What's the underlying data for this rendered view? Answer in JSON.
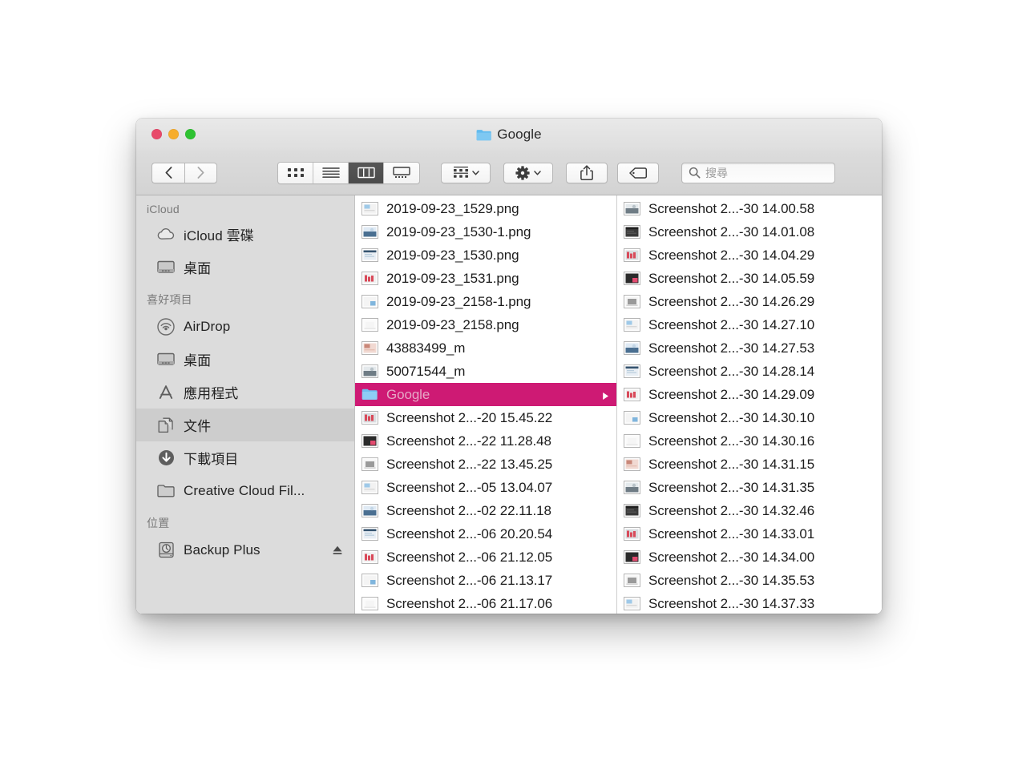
{
  "window": {
    "title": "Google",
    "title_icon": "blue-folder-icon",
    "traffic_lights": [
      {
        "name": "close",
        "color": "#e8496a"
      },
      {
        "name": "minimize",
        "color": "#f6ad2d"
      },
      {
        "name": "maximize",
        "color": "#2ec231"
      }
    ]
  },
  "toolbar": {
    "back_label": "",
    "forward_label": "",
    "view_modes": [
      {
        "name": "icon-view",
        "active": false
      },
      {
        "name": "list-view",
        "active": false
      },
      {
        "name": "column-view",
        "active": true
      },
      {
        "name": "gallery-view",
        "active": false
      }
    ],
    "arrange_label": "",
    "action_label": "",
    "share_label": "",
    "tag_label": "",
    "accent_selected": "#4b4b4b"
  },
  "search": {
    "placeholder": "搜尋",
    "value": ""
  },
  "sidebar": {
    "sections": [
      {
        "title": "iCloud",
        "items": [
          {
            "label": "iCloud 雲碟",
            "icon": "cloud-icon",
            "selected": false,
            "eject": false
          },
          {
            "label": "桌面",
            "icon": "desktop-icon",
            "selected": false,
            "eject": false
          }
        ]
      },
      {
        "title": "喜好項目",
        "items": [
          {
            "label": "AirDrop",
            "icon": "airdrop-icon",
            "selected": false,
            "eject": false
          },
          {
            "label": "桌面",
            "icon": "desktop-icon",
            "selected": false,
            "eject": false
          },
          {
            "label": "應用程式",
            "icon": "applications-icon",
            "selected": false,
            "eject": false
          },
          {
            "label": "文件",
            "icon": "documents-icon",
            "selected": true,
            "eject": false
          },
          {
            "label": "下載項目",
            "icon": "downloads-icon",
            "selected": false,
            "eject": false
          },
          {
            "label": "Creative Cloud Fil...",
            "icon": "folder-icon",
            "selected": false,
            "eject": false
          }
        ]
      },
      {
        "title": "位置",
        "items": [
          {
            "label": "Backup Plus",
            "icon": "backup-disk-icon",
            "selected": false,
            "eject": true
          }
        ]
      }
    ]
  },
  "browser": {
    "selection_color": "#ce1a74",
    "columns": [
      {
        "name": "column-1",
        "rows": [
          {
            "name": "2019-09-23_1529.png",
            "icon": "image-thumbnail",
            "kind": "file",
            "selected": false,
            "disclosure": false
          },
          {
            "name": "2019-09-23_1530-1.png",
            "icon": "image-thumbnail",
            "kind": "file",
            "selected": false,
            "disclosure": false
          },
          {
            "name": "2019-09-23_1530.png",
            "icon": "image-thumbnail",
            "kind": "file",
            "selected": false,
            "disclosure": false
          },
          {
            "name": "2019-09-23_1531.png",
            "icon": "image-thumbnail",
            "kind": "file",
            "selected": false,
            "disclosure": false
          },
          {
            "name": "2019-09-23_2158-1.png",
            "icon": "image-thumbnail",
            "kind": "file",
            "selected": false,
            "disclosure": false
          },
          {
            "name": "2019-09-23_2158.png",
            "icon": "image-thumbnail",
            "kind": "file",
            "selected": false,
            "disclosure": false
          },
          {
            "name": "43883499_m",
            "icon": "image-thumbnail",
            "kind": "file",
            "selected": false,
            "disclosure": false
          },
          {
            "name": "50071544_m",
            "icon": "image-thumbnail",
            "kind": "file",
            "selected": false,
            "disclosure": false
          },
          {
            "name": "Google",
            "icon": "blue-folder-icon",
            "kind": "folder",
            "selected": true,
            "disclosure": true
          },
          {
            "name": "Screenshot 2...-20 15.45.22",
            "icon": "image-thumbnail",
            "kind": "file",
            "selected": false,
            "disclosure": false
          },
          {
            "name": "Screenshot 2...-22 11.28.48",
            "icon": "image-thumbnail",
            "kind": "file",
            "selected": false,
            "disclosure": false
          },
          {
            "name": "Screenshot 2...-22 13.45.25",
            "icon": "image-thumbnail",
            "kind": "file",
            "selected": false,
            "disclosure": false
          },
          {
            "name": "Screenshot 2...-05 13.04.07",
            "icon": "image-thumbnail",
            "kind": "file",
            "selected": false,
            "disclosure": false
          },
          {
            "name": "Screenshot 2...-02 22.11.18",
            "icon": "image-thumbnail",
            "kind": "file",
            "selected": false,
            "disclosure": false
          },
          {
            "name": "Screenshot 2...-06 20.20.54",
            "icon": "image-thumbnail",
            "kind": "file",
            "selected": false,
            "disclosure": false
          },
          {
            "name": "Screenshot 2...-06 21.12.05",
            "icon": "image-thumbnail",
            "kind": "file",
            "selected": false,
            "disclosure": false
          },
          {
            "name": "Screenshot 2...-06 21.13.17",
            "icon": "image-thumbnail",
            "kind": "file",
            "selected": false,
            "disclosure": false
          },
          {
            "name": "Screenshot 2...-06 21.17.06",
            "icon": "image-thumbnail",
            "kind": "file",
            "selected": false,
            "disclosure": false
          }
        ]
      },
      {
        "name": "column-2",
        "rows": [
          {
            "name": "Screenshot 2...-30 14.00.58",
            "icon": "image-thumbnail",
            "kind": "file",
            "selected": false,
            "disclosure": false
          },
          {
            "name": "Screenshot 2...-30 14.01.08",
            "icon": "image-thumbnail",
            "kind": "file",
            "selected": false,
            "disclosure": false
          },
          {
            "name": "Screenshot 2...-30 14.04.29",
            "icon": "image-thumbnail",
            "kind": "file",
            "selected": false,
            "disclosure": false
          },
          {
            "name": "Screenshot 2...-30 14.05.59",
            "icon": "image-thumbnail",
            "kind": "file",
            "selected": false,
            "disclosure": false
          },
          {
            "name": "Screenshot 2...-30 14.26.29",
            "icon": "image-thumbnail",
            "kind": "file",
            "selected": false,
            "disclosure": false
          },
          {
            "name": "Screenshot 2...-30 14.27.10",
            "icon": "image-thumbnail",
            "kind": "file",
            "selected": false,
            "disclosure": false
          },
          {
            "name": "Screenshot 2...-30 14.27.53",
            "icon": "image-thumbnail",
            "kind": "file",
            "selected": false,
            "disclosure": false
          },
          {
            "name": "Screenshot 2...-30 14.28.14",
            "icon": "image-thumbnail",
            "kind": "file",
            "selected": false,
            "disclosure": false
          },
          {
            "name": "Screenshot 2...-30 14.29.09",
            "icon": "image-thumbnail",
            "kind": "file",
            "selected": false,
            "disclosure": false
          },
          {
            "name": "Screenshot 2...-30 14.30.10",
            "icon": "image-thumbnail",
            "kind": "file",
            "selected": false,
            "disclosure": false
          },
          {
            "name": "Screenshot 2...-30 14.30.16",
            "icon": "image-thumbnail",
            "kind": "file",
            "selected": false,
            "disclosure": false
          },
          {
            "name": "Screenshot 2...-30 14.31.15",
            "icon": "image-thumbnail",
            "kind": "file",
            "selected": false,
            "disclosure": false
          },
          {
            "name": "Screenshot 2...-30 14.31.35",
            "icon": "image-thumbnail",
            "kind": "file",
            "selected": false,
            "disclosure": false
          },
          {
            "name": "Screenshot 2...-30 14.32.46",
            "icon": "image-thumbnail",
            "kind": "file",
            "selected": false,
            "disclosure": false
          },
          {
            "name": "Screenshot 2...-30 14.33.01",
            "icon": "image-thumbnail",
            "kind": "file",
            "selected": false,
            "disclosure": false
          },
          {
            "name": "Screenshot 2...-30 14.34.00",
            "icon": "image-thumbnail",
            "kind": "file",
            "selected": false,
            "disclosure": false
          },
          {
            "name": "Screenshot 2...-30 14.35.53",
            "icon": "image-thumbnail",
            "kind": "file",
            "selected": false,
            "disclosure": false
          },
          {
            "name": "Screenshot 2...-30 14.37.33",
            "icon": "image-thumbnail",
            "kind": "file",
            "selected": false,
            "disclosure": false
          }
        ]
      }
    ]
  }
}
